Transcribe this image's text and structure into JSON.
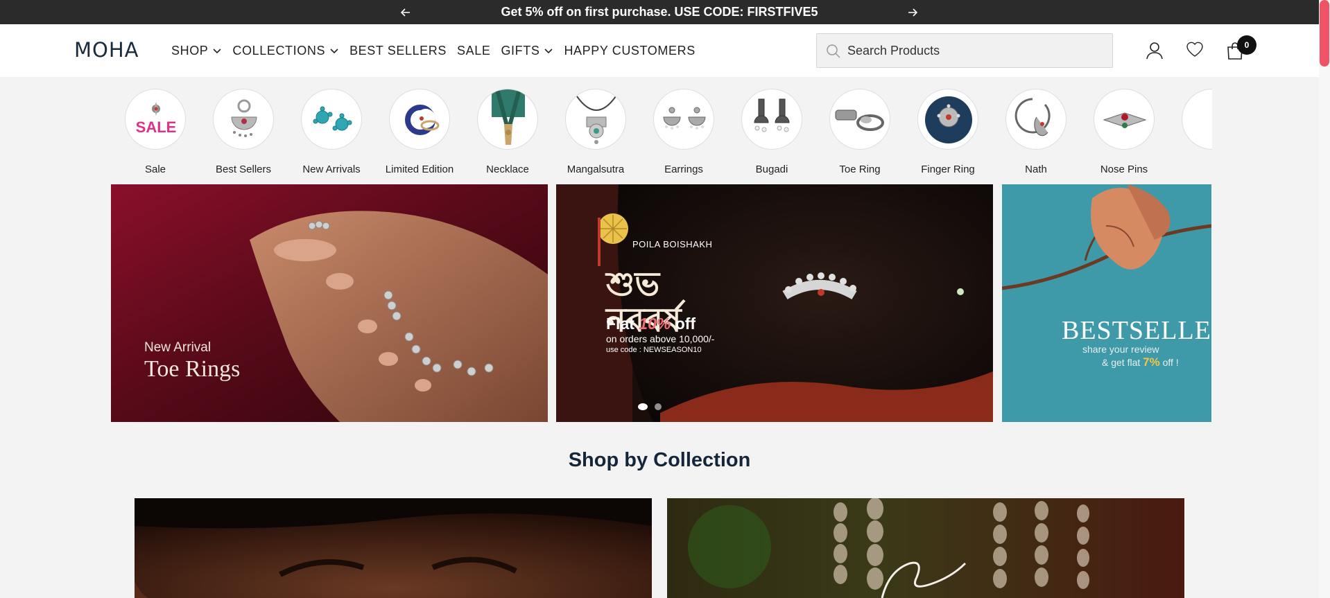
{
  "announcement": {
    "text": "Get 5% off on first purchase. USE CODE: FIRSTFIVE5"
  },
  "header": {
    "logo": "MOHA",
    "nav": [
      {
        "label": "SHOP",
        "dropdown": true
      },
      {
        "label": "COLLECTIONS",
        "dropdown": true
      },
      {
        "label": "BEST SELLERS",
        "dropdown": false
      },
      {
        "label": "SALE",
        "dropdown": false
      },
      {
        "label": "GIFTS",
        "dropdown": true
      },
      {
        "label": "HAPPY CUSTOMERS",
        "dropdown": false
      }
    ],
    "search": {
      "placeholder": "Search Products",
      "value": ""
    },
    "icons": [
      "account-icon",
      "wishlist-heart-icon",
      "cart-bag-icon"
    ],
    "cart_count": "0"
  },
  "categories": [
    {
      "label": "Sale",
      "icon": "sale-tag"
    },
    {
      "label": "Best Sellers",
      "icon": "chandbali-earring"
    },
    {
      "label": "New Arrivals",
      "icon": "turquoise-studs"
    },
    {
      "label": "Limited Edition",
      "icon": "crescent-ring"
    },
    {
      "label": "Necklace",
      "icon": "beaded-necklace"
    },
    {
      "label": "Mangalsutra",
      "icon": "pendant-necklace"
    },
    {
      "label": "Earrings",
      "icon": "drop-earrings"
    },
    {
      "label": "Bugadi",
      "icon": "jhumka"
    },
    {
      "label": "Toe Ring",
      "icon": "toe-ring"
    },
    {
      "label": "Finger Ring",
      "icon": "finger-ring"
    },
    {
      "label": "Nath",
      "icon": "nose-ring"
    },
    {
      "label": "Nose Pins",
      "icon": "nose-pin"
    }
  ],
  "banners": {
    "b1": {
      "small": "New Arrival",
      "big": "Toe Rings"
    },
    "b2": {
      "top": "POILA BOISHAKH",
      "bengali": "শুভ নববর্ষ",
      "flat_prefix": "Flat ",
      "flat_pct": "10%",
      "flat_suffix": " off",
      "above": "on orders above 10,000/-",
      "code": "use code : NEWSEASON10"
    },
    "b3": {
      "title": "BESTSELLER",
      "line1": "share your review",
      "line2_prefix": "& get flat ",
      "line2_pct": "7%",
      "line2_suffix": " off !"
    },
    "slide_count": 2,
    "active_slide": 1
  },
  "collection_section": {
    "title": "Shop by Collection"
  },
  "colors": {
    "announcement_bg": "#2b2b2b",
    "accent": "#ef5365",
    "heading": "#15263a"
  }
}
